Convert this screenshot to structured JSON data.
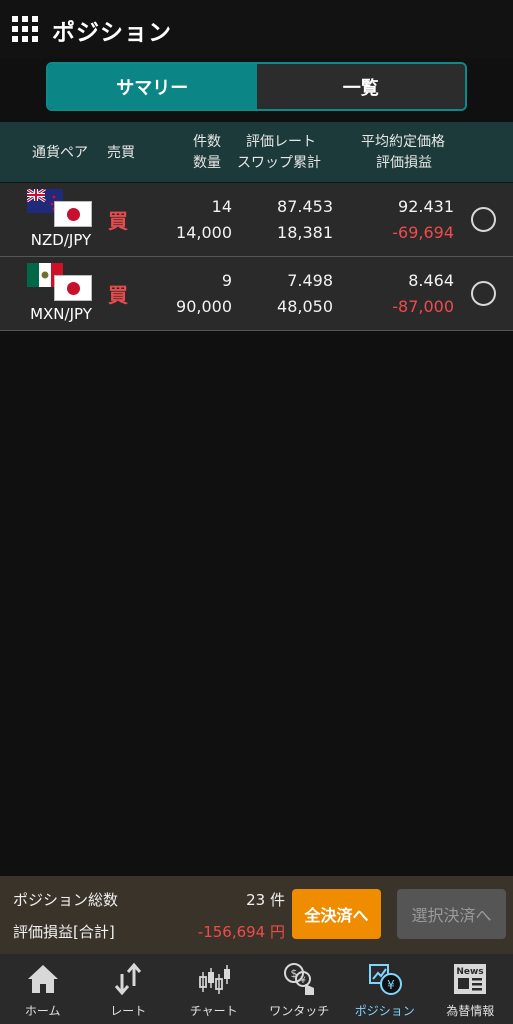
{
  "header": {
    "title": "ポジション",
    "menu_icon": "grid-menu-icon"
  },
  "tabs": [
    {
      "label": "サマリー",
      "active": true
    },
    {
      "label": "一覧",
      "active": false
    }
  ],
  "columns": {
    "pair": "通貨ペア",
    "side": "売買",
    "count": "件数",
    "quantity": "数量",
    "rate": "評価レート",
    "swap": "スワップ累計",
    "avg_price": "平均約定価格",
    "pnl": "評価損益"
  },
  "positions": [
    {
      "pair": "NZD/JPY",
      "flag_base": "nz-flag-icon",
      "flag_quote": "jp-flag-icon",
      "side": "買",
      "count": "14",
      "quantity": "14,000",
      "rate": "87.453",
      "swap": "18,381",
      "avg_price": "92.431",
      "pnl": "-69,694"
    },
    {
      "pair": "MXN/JPY",
      "flag_base": "mx-flag-icon",
      "flag_quote": "jp-flag-icon",
      "side": "買",
      "count": "9",
      "quantity": "90,000",
      "rate": "7.498",
      "swap": "48,050",
      "avg_price": "8.464",
      "pnl": "-87,000"
    }
  ],
  "summary": {
    "total_label": "ポジション総数",
    "total_value": "23 件",
    "pnl_label": "評価損益[合計]",
    "pnl_value": "-156,694 円",
    "settle_all": "全決済へ",
    "settle_selected": "選択決済へ"
  },
  "nav": [
    {
      "label": "ホーム",
      "icon": "home-icon",
      "active": false
    },
    {
      "label": "レート",
      "icon": "rate-arrows-icon",
      "active": false
    },
    {
      "label": "チャート",
      "icon": "candlestick-chart-icon",
      "active": false
    },
    {
      "label": "ワンタッチ",
      "icon": "one-touch-icon",
      "active": false
    },
    {
      "label": "ポジション",
      "icon": "position-icon",
      "active": true
    },
    {
      "label": "為替情報",
      "icon": "news-icon",
      "active": false
    }
  ],
  "colors": {
    "accent_teal": "#0b8585",
    "loss_red": "#ef4b4b",
    "settle_orange": "#f08c00",
    "active_nav": "#7fd6ff"
  }
}
